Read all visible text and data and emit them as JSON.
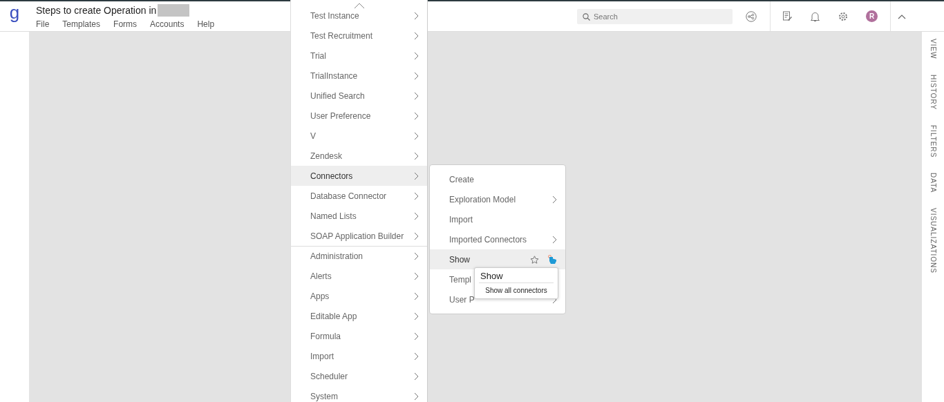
{
  "header": {
    "logo": "g",
    "title": "Steps to create Operation in",
    "redacted": true,
    "menu": [
      "File",
      "Templates",
      "Forms",
      "Accounts",
      "Help"
    ],
    "search": {
      "placeholder": "Search"
    },
    "avatar": "R"
  },
  "side_tabs": [
    "VIEW",
    "HISTORY",
    "FILTERS",
    "DATA",
    "VISUALIZATIONS"
  ],
  "menu": {
    "sections": [
      [
        {
          "label": "Test Instance",
          "submenu": true,
          "selected": false
        },
        {
          "label": "Test Recruitment",
          "submenu": true,
          "selected": false
        },
        {
          "label": "Trial",
          "submenu": true,
          "selected": false
        },
        {
          "label": "TrialInstance",
          "submenu": true,
          "selected": false
        },
        {
          "label": "Unified Search",
          "submenu": true,
          "selected": false
        },
        {
          "label": "User Preference",
          "submenu": true,
          "selected": false
        },
        {
          "label": "V",
          "submenu": true,
          "selected": false
        },
        {
          "label": "Zendesk",
          "submenu": true,
          "selected": false
        },
        {
          "label": "Connectors",
          "submenu": true,
          "selected": true
        },
        {
          "label": "Database Connector",
          "submenu": true,
          "selected": false
        },
        {
          "label": "Named Lists",
          "submenu": true,
          "selected": false
        },
        {
          "label": "SOAP Application Builder",
          "submenu": true,
          "selected": false
        }
      ],
      [
        {
          "label": "Administration",
          "submenu": true,
          "selected": false
        },
        {
          "label": "Alerts",
          "submenu": true,
          "selected": false
        },
        {
          "label": "Apps",
          "submenu": true,
          "selected": false
        },
        {
          "label": "Editable App",
          "submenu": true,
          "selected": false
        },
        {
          "label": "Formula",
          "submenu": true,
          "selected": false
        },
        {
          "label": "Import",
          "submenu": true,
          "selected": false
        },
        {
          "label": "Scheduler",
          "submenu": true,
          "selected": false
        },
        {
          "label": "System",
          "submenu": true,
          "selected": false
        }
      ]
    ]
  },
  "submenu": {
    "items": [
      {
        "label": "Create",
        "submenu": false,
        "selected": false
      },
      {
        "label": "Exploration Model",
        "submenu": true,
        "selected": false
      },
      {
        "label": "Import",
        "submenu": false,
        "selected": false
      },
      {
        "label": "Imported Connectors",
        "submenu": true,
        "selected": false
      },
      {
        "label": "Show",
        "submenu": false,
        "selected": true
      },
      {
        "label": "Templ",
        "selected": false
      },
      {
        "label": "User P",
        "submenu": true,
        "selected": false
      }
    ]
  },
  "tooltip": {
    "title": "Show",
    "text": "Show all connectors"
  }
}
